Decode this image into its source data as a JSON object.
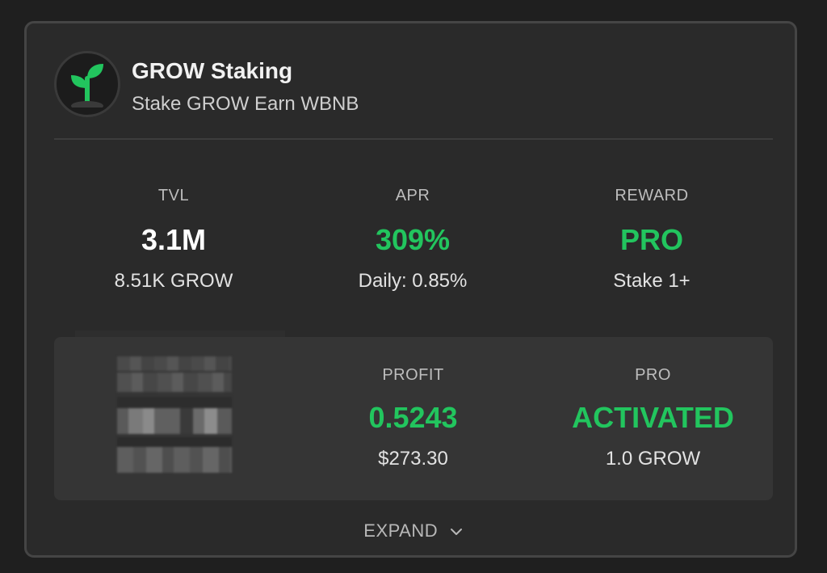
{
  "pool": {
    "title": "GROW Staking",
    "subtitle": "Stake GROW Earn WBNB",
    "logo_icon": "sprout-icon"
  },
  "stats": {
    "tvl": {
      "label": "TVL",
      "value": "3.1M",
      "sub": "8.51K GROW"
    },
    "apr": {
      "label": "APR",
      "value": "309%",
      "sub": "Daily: 0.85%"
    },
    "reward": {
      "label": "REWARD",
      "value": "PRO",
      "sub": "Stake 1+"
    }
  },
  "user": {
    "profit": {
      "label": "PROFIT",
      "value": "0.5243",
      "sub": "$273.30"
    },
    "pro": {
      "label": "PRO",
      "value": "ACTIVATED",
      "sub": "1.0 GROW"
    }
  },
  "expand": {
    "label": "EXPAND",
    "icon": "chevron-down-icon"
  },
  "colors": {
    "accent_green": "#22c55e",
    "card_bg": "#2a2a2a",
    "panel_bg": "#353535",
    "page_bg": "#1f1f1f"
  }
}
